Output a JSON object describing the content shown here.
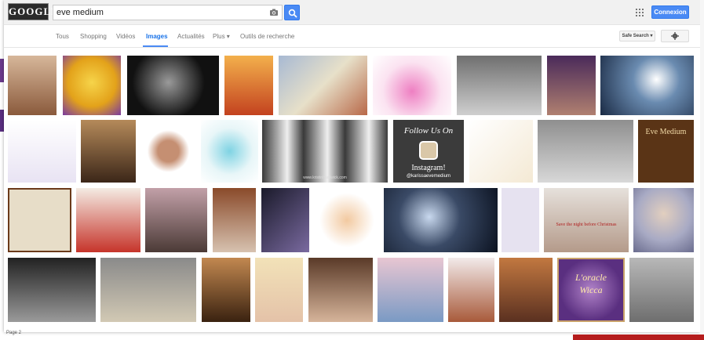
{
  "header": {
    "logo_text": "GOOGLE",
    "search_value": "eve medium",
    "signin_label": "Connexion"
  },
  "tabs": [
    {
      "label": "Tous"
    },
    {
      "label": "Shopping"
    },
    {
      "label": "Vidéos"
    },
    {
      "label": "Images",
      "active": true
    },
    {
      "label": "Actualités"
    },
    {
      "label": "Plus ▾"
    },
    {
      "label": "Outils de recherche"
    }
  ],
  "toolbar": {
    "safe_search_label": "Safe Search ▾"
  },
  "thumbnails": {
    "follow_us": "Follow Us On",
    "instagram": "Instagram!",
    "instagram_handle": "@karissaevemedium",
    "eve_medium": "Eve Medium",
    "oracle": "L'oracle",
    "wicca": "Wicca",
    "save_night": "Save the night before Christmas",
    "site_credit": "www.kristinhardwick.com"
  },
  "footer": {
    "page_label": "Page 2"
  },
  "colors": {
    "accent": "#4a8af4",
    "active_tab": "#1a73e8"
  }
}
